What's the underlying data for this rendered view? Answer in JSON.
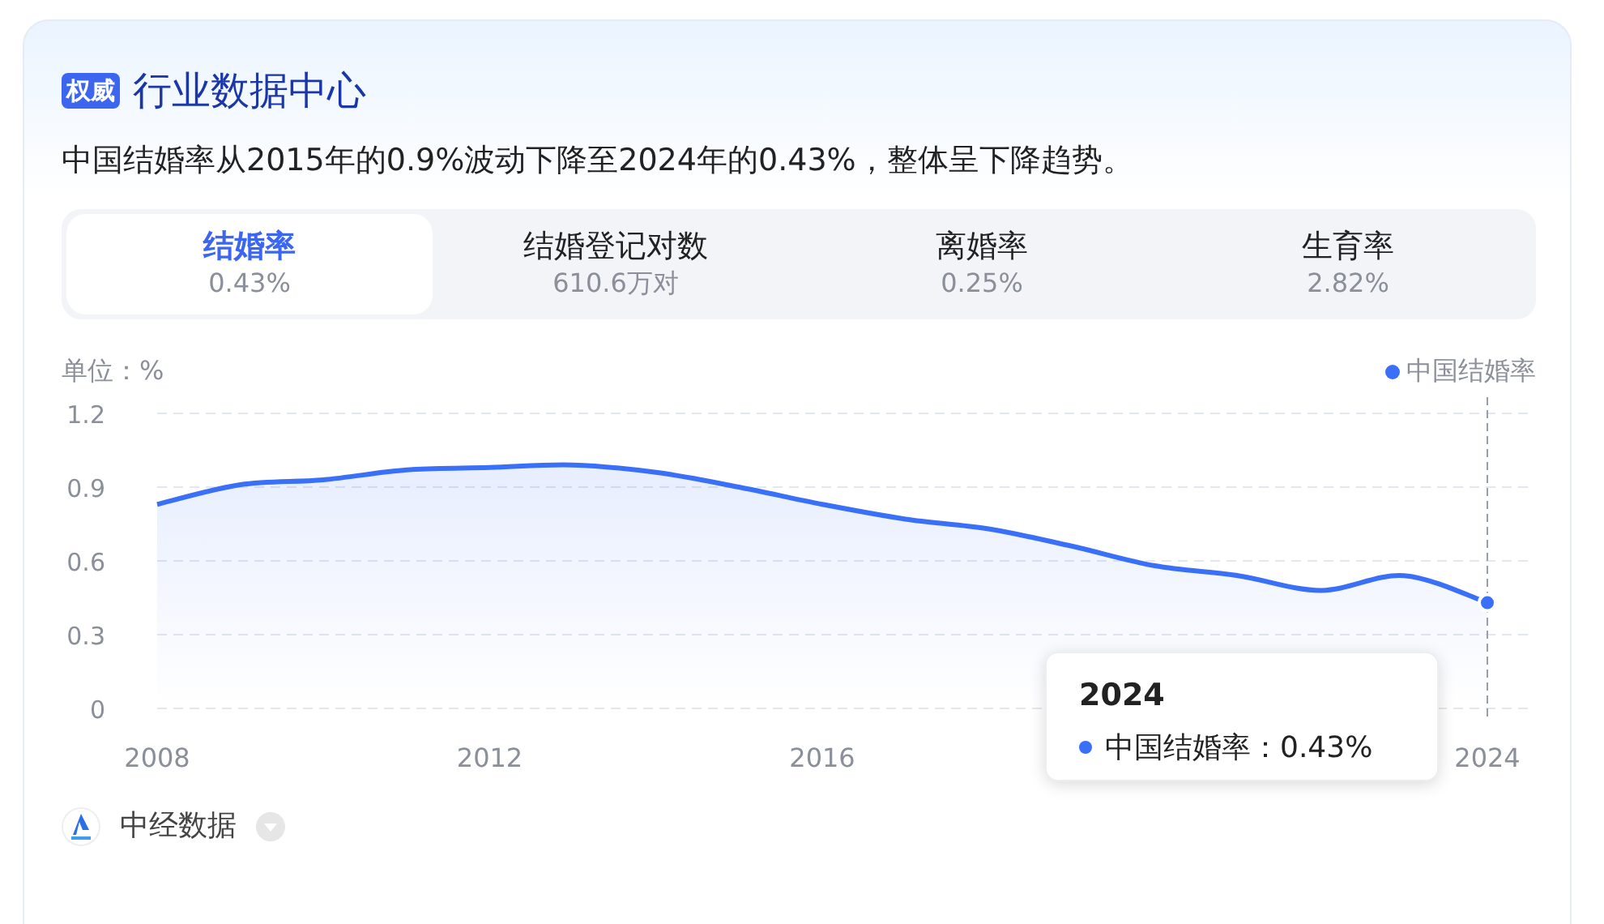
{
  "header": {
    "badge": "权威",
    "title": "行业数据中心"
  },
  "summary": "中国结婚率从2015年的0.9%波动下降至2024年的0.43%，整体呈下降趋势。",
  "tabs": [
    {
      "label": "结婚率",
      "value": "0.43%",
      "selected": true
    },
    {
      "label": "结婚登记对数",
      "value": "610.6万对",
      "selected": false
    },
    {
      "label": "离婚率",
      "value": "0.25%",
      "selected": false
    },
    {
      "label": "生育率",
      "value": "2.82%",
      "selected": false
    }
  ],
  "unit": "单位：%",
  "chart_data": {
    "type": "area",
    "x": [
      2008,
      2009,
      2010,
      2011,
      2012,
      2013,
      2014,
      2015,
      2016,
      2017,
      2018,
      2019,
      2020,
      2021,
      2022,
      2023,
      2024
    ],
    "series": [
      {
        "name": "中国结婚率",
        "color": "#3a6ff7",
        "values": [
          0.83,
          0.91,
          0.93,
          0.97,
          0.98,
          0.99,
          0.96,
          0.9,
          0.83,
          0.77,
          0.73,
          0.66,
          0.58,
          0.54,
          0.48,
          0.54,
          0.43
        ]
      }
    ],
    "xlim": [
      2008,
      2024
    ],
    "ylim": [
      0,
      1.2
    ],
    "yticks": [
      0,
      0.3,
      0.6,
      0.9,
      1.2
    ],
    "xticks": [
      2008,
      2012,
      2016,
      2024
    ],
    "grid": true
  },
  "tooltip": {
    "title": "2024",
    "label": "中国结婚率：0.43%"
  },
  "source": {
    "name": "中经数据"
  }
}
